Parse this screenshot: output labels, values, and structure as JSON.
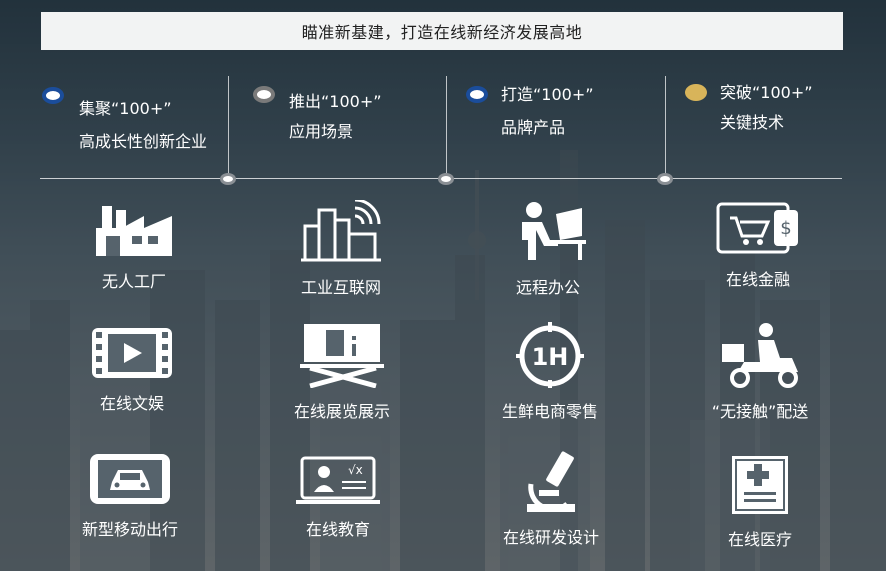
{
  "banner": {
    "title": "瞄准新基建，打造在线新经济发展高地"
  },
  "colors": {
    "blue_dot": "#1b4d9b",
    "gray_dot": "#7a7a7a",
    "gold_dot": "#d8b45a",
    "banner_bg": "#f2f3f3"
  },
  "goals": [
    {
      "line1": "集聚“100+”",
      "line2": "高成长性创新企业",
      "dot_color": "#1b4d9b"
    },
    {
      "line1": "推出“100+”",
      "line2": "应用场景",
      "dot_color": "#7a7a7a"
    },
    {
      "line1": "打造“100+”",
      "line2": "品牌产品",
      "dot_color": "#1b4d9b"
    },
    {
      "line1": "突破“100+”",
      "line2": "关键技术",
      "dot_color": "#d8b45a"
    }
  ],
  "tiles": [
    {
      "label": "无人工厂",
      "icon": "factory-icon"
    },
    {
      "label": "工业互联网",
      "icon": "industrial-internet-icon"
    },
    {
      "label": "远程办公",
      "icon": "remote-office-icon"
    },
    {
      "label": "在线金融",
      "icon": "online-finance-icon"
    },
    {
      "label": "在线文娱",
      "icon": "video-play-icon"
    },
    {
      "label": "在线展览展示",
      "icon": "exhibition-board-icon"
    },
    {
      "label": "生鲜电商零售",
      "icon": "one-hour-clock-icon"
    },
    {
      "label": "“无接触”配送",
      "icon": "delivery-scooter-icon"
    },
    {
      "label": "新型移动出行",
      "icon": "car-phone-icon"
    },
    {
      "label": "在线教育",
      "icon": "online-education-icon"
    },
    {
      "label": "在线研发设计",
      "icon": "microscope-icon"
    },
    {
      "label": "在线医疗",
      "icon": "medical-record-icon"
    }
  ]
}
